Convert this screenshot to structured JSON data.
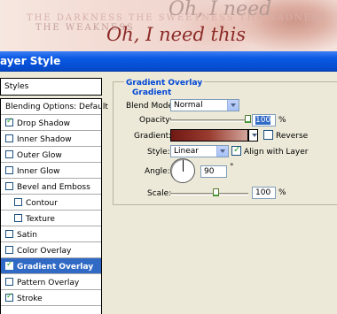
{
  "banner": {
    "line1": "Oh, I need",
    "line2": "THE DARKNESS THE SWEETNESS THE SADNESS",
    "line3": "THE WEAKNESS",
    "line4": "Oh, I need this"
  },
  "window": {
    "title": "ayer Style"
  },
  "styles_header": "Styles",
  "style_items": [
    {
      "label": "Blending Options: Default",
      "checkbox": false,
      "checked": false,
      "selected": false,
      "indent": false
    },
    {
      "label": "Drop Shadow",
      "checkbox": true,
      "checked": true,
      "selected": false,
      "indent": false
    },
    {
      "label": "Inner Shadow",
      "checkbox": true,
      "checked": false,
      "selected": false,
      "indent": false
    },
    {
      "label": "Outer Glow",
      "checkbox": true,
      "checked": false,
      "selected": false,
      "indent": false
    },
    {
      "label": "Inner Glow",
      "checkbox": true,
      "checked": false,
      "selected": false,
      "indent": false
    },
    {
      "label": "Bevel and Emboss",
      "checkbox": true,
      "checked": false,
      "selected": false,
      "indent": false
    },
    {
      "label": "Contour",
      "checkbox": true,
      "checked": false,
      "selected": false,
      "indent": true
    },
    {
      "label": "Texture",
      "checkbox": true,
      "checked": false,
      "selected": false,
      "indent": true
    },
    {
      "label": "Satin",
      "checkbox": true,
      "checked": false,
      "selected": false,
      "indent": false
    },
    {
      "label": "Color Overlay",
      "checkbox": true,
      "checked": false,
      "selected": false,
      "indent": false
    },
    {
      "label": "Gradient Overlay",
      "checkbox": true,
      "checked": true,
      "selected": true,
      "indent": false
    },
    {
      "label": "Pattern Overlay",
      "checkbox": true,
      "checked": false,
      "selected": false,
      "indent": false
    },
    {
      "label": "Stroke",
      "checkbox": true,
      "checked": true,
      "selected": false,
      "indent": false
    }
  ],
  "panel": {
    "group_title": "Gradient Overlay",
    "sub_title": "Gradient",
    "blend_mode_label": "Blend Mode:",
    "blend_mode_value": "Normal",
    "opacity_label": "Opacity:",
    "opacity_value": "100",
    "opacity_unit": "%",
    "opacity_level": 1.0,
    "gradient_label": "Gradient:",
    "reverse_label": "Reverse",
    "reverse_checked": false,
    "style_label": "Style:",
    "style_value": "Linear",
    "align_label": "Align with Layer",
    "align_checked": true,
    "angle_label": "Angle:",
    "angle_value": "90",
    "angle_unit": "°",
    "scale_label": "Scale:",
    "scale_value": "100",
    "scale_unit": "%",
    "gradient_colors": [
      "#6f1813",
      "#9a3c30",
      "#d2a69c"
    ]
  }
}
